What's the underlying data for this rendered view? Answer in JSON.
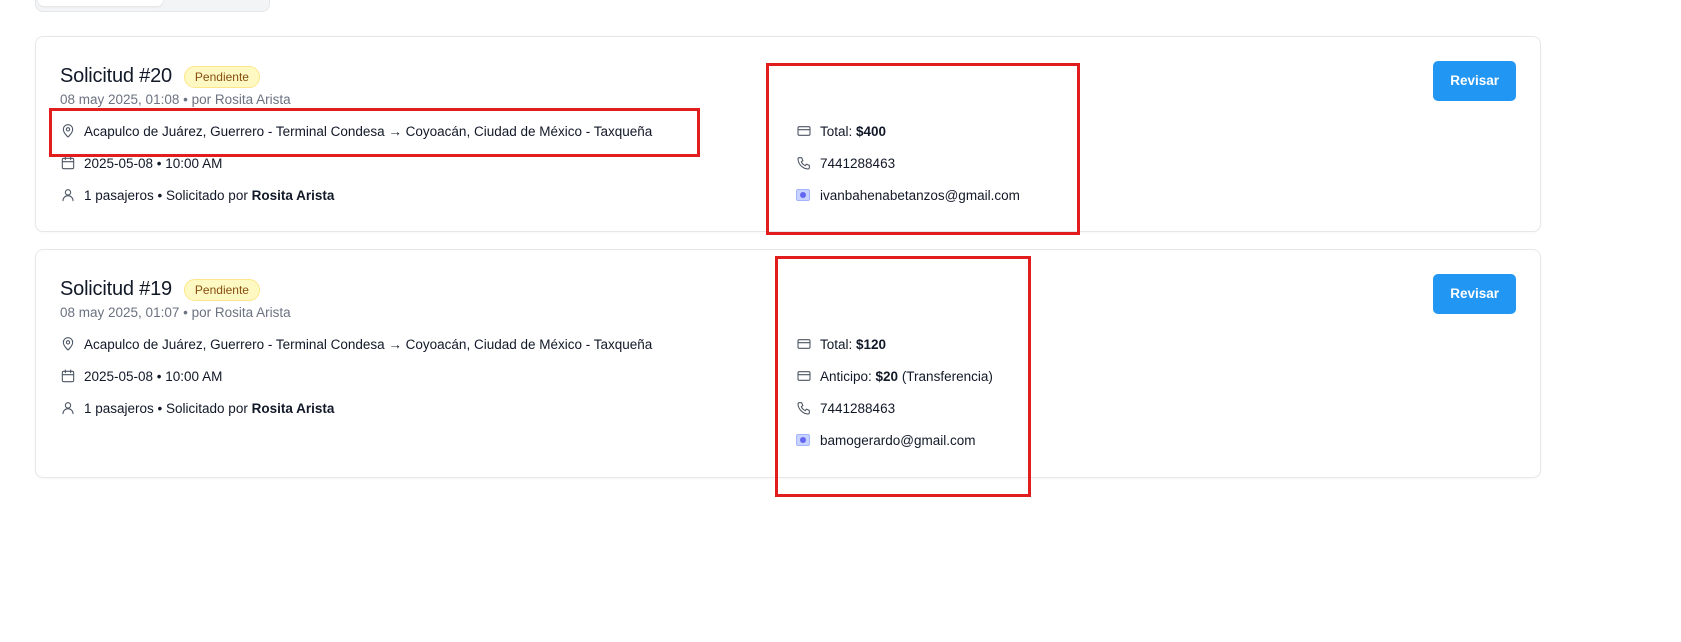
{
  "requests": [
    {
      "title": "Solicitud #20",
      "status": "Pendiente",
      "meta": "08 may 2025, 01:08 • por Rosita Arista",
      "route": "Acapulco de Juárez, Guerrero - Terminal Condesa → Coyoacán, Ciudad de México - Taxqueña",
      "datetime": "2025-05-08 • 10:00 AM",
      "passengers_prefix": "1 pasajeros • Solicitado por ",
      "requester": "Rosita Arista",
      "total_label": "Total: ",
      "total": "$400",
      "phone": "7441288463",
      "email": "ivanbahenabetanzos@gmail.com",
      "action_label": "Revisar"
    },
    {
      "title": "Solicitud #19",
      "status": "Pendiente",
      "meta": "08 may 2025, 01:07 • por Rosita Arista",
      "route": "Acapulco de Juárez, Guerrero - Terminal Condesa → Coyoacán, Ciudad de México - Taxqueña",
      "datetime": "2025-05-08 • 10:00 AM",
      "passengers_prefix": "1 pasajeros • Solicitado por ",
      "requester": "Rosita Arista",
      "total_label": "Total: ",
      "total": "$120",
      "deposit_label": "Anticipo: ",
      "deposit": "$20",
      "deposit_method": " (Transferencia)",
      "phone": "7441288463",
      "email": "bamogerardo@gmail.com",
      "action_label": "Revisar"
    }
  ],
  "icons": {
    "location": "map-pin-icon",
    "calendar": "calendar-icon",
    "user": "user-icon",
    "card": "credit-card-icon",
    "phone": "phone-icon",
    "email": "email-image-icon"
  },
  "colors": {
    "accent": "#2196f3",
    "badge_bg": "#fef9c3",
    "badge_text": "#854d0e",
    "highlight": "#e11d1d"
  }
}
